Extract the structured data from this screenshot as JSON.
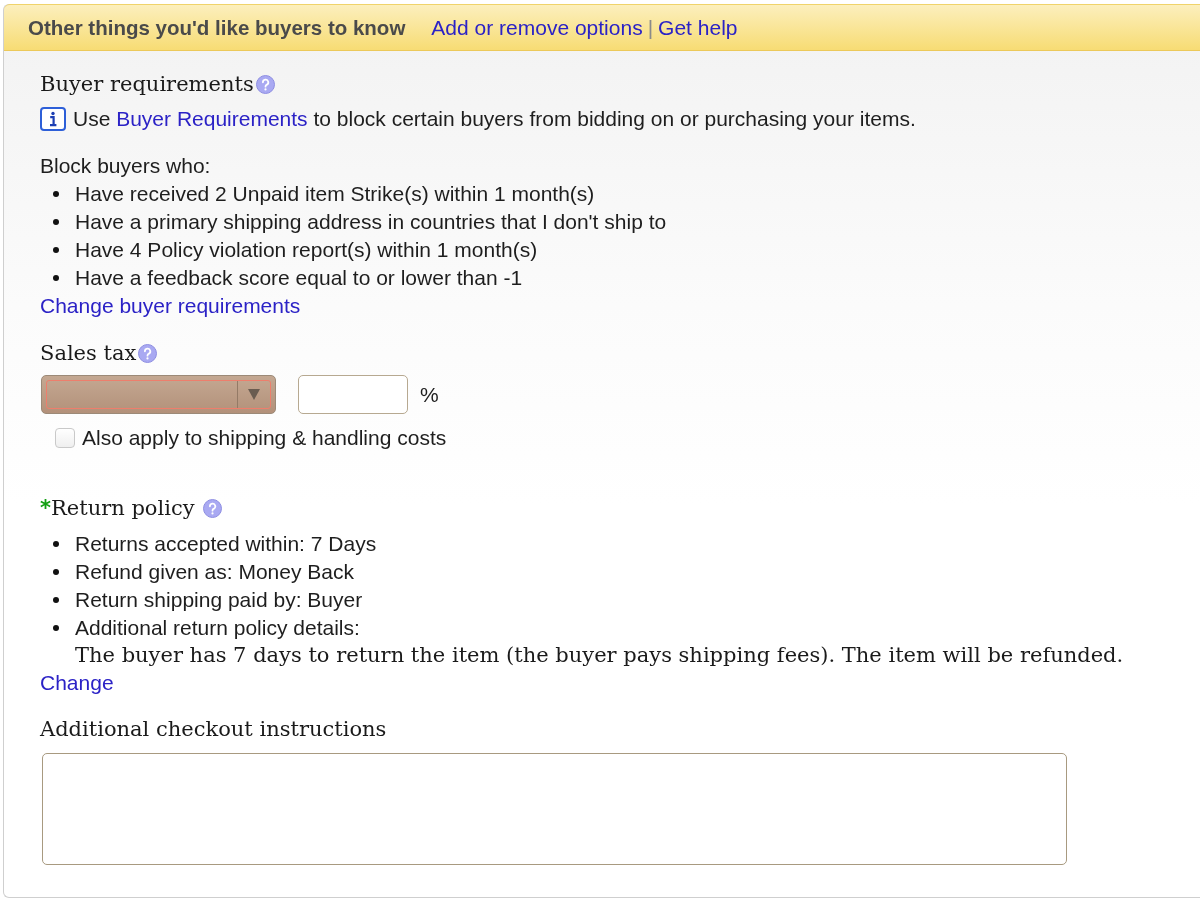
{
  "header": {
    "title": "Other things you'd like buyers to know",
    "links": [
      "Add or remove options",
      "Get help"
    ],
    "separator": "|"
  },
  "buyer_requirements": {
    "title": "Buyer requirements",
    "notice": {
      "before": "Use",
      "link": "Buyer Requirements",
      "after": "to block certain buyers from bidding on or purchasing your items."
    },
    "block_label": "Block buyers who:",
    "rules": [
      "Have received 2 Unpaid item Strike(s) within 1 month(s)",
      "Have a primary shipping address in countries that I don't ship to",
      "Have 4 Policy violation report(s) within 1 month(s)",
      "Have a feedback score equal to or lower than -1"
    ],
    "change_link": "Change buyer requirements"
  },
  "sales_tax": {
    "title": "Sales tax",
    "state_select": {
      "invalid": true
    },
    "percent_sign": "%",
    "shipping_checkbox": {
      "label": "Also apply to shipping & handling costs",
      "checked": false
    }
  },
  "return_policy": {
    "required_mark": "*",
    "title": "Return policy",
    "items": [
      {
        "label": "Returns accepted within:",
        "value": "7 Days"
      },
      {
        "label": "Refund given as:",
        "value": "Money Back"
      },
      {
        "label": "Return shipping paid by:",
        "value": "Buyer"
      },
      {
        "label": "Additional return policy details:"
      }
    ],
    "details": "The buyer has 7 days to return the item (the buyer pays shipping fees). The item will be refunded.",
    "change_link": "Change"
  },
  "checkout_instructions": {
    "label": "Additional checkout instructions"
  }
}
